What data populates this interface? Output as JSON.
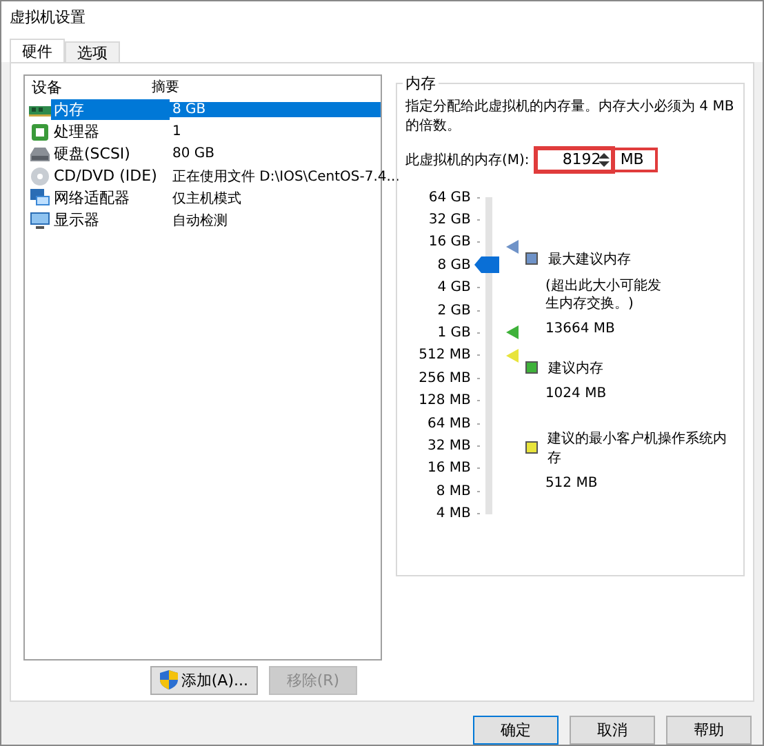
{
  "window": {
    "title": "虚拟机设置"
  },
  "tabs": [
    {
      "label": "硬件",
      "selected": true
    },
    {
      "label": "选项",
      "selected": false
    }
  ],
  "device_table": {
    "columns": [
      "设备",
      "摘要"
    ],
    "rows": [
      {
        "kind": "memory",
        "device": "内存",
        "summary": "8 GB",
        "selected": true
      },
      {
        "kind": "cpu",
        "device": "处理器",
        "summary": "1",
        "selected": false
      },
      {
        "kind": "disk",
        "device": "硬盘(SCSI)",
        "summary": "80 GB",
        "selected": false
      },
      {
        "kind": "cd",
        "device": "CD/DVD (IDE)",
        "summary": "正在使用文件 D:\\IOS\\CentOS-7.4...",
        "selected": false
      },
      {
        "kind": "network",
        "device": "网络适配器",
        "summary": "仅主机模式",
        "selected": false
      },
      {
        "kind": "display",
        "device": "显示器",
        "summary": "自动检测",
        "selected": false
      }
    ]
  },
  "device_buttons": [
    {
      "kind": "shield",
      "label": "添加(A)...",
      "disabled": false
    },
    {
      "kind": "plain",
      "label": "移除(R)",
      "disabled": true
    }
  ],
  "memory": {
    "title": "内存",
    "description": "指定分配给此虚拟机的内存量。内存大小必须为 4 MB 的倍数。",
    "field_label": "此虚拟机的内存(M):",
    "value": "8192",
    "unit": "MB",
    "level": 0.786,
    "scale": [
      "64 GB",
      "32 GB",
      "16 GB",
      "8 GB",
      "4 GB",
      "2 GB",
      "1 GB",
      "512 MB",
      "256 MB",
      "128 MB",
      "64 MB",
      "32 MB",
      "16 MB",
      "8 MB",
      "4 MB"
    ],
    "recommendations": [
      {
        "label": "最大建议内存",
        "note": "(超出此大小可能发生内存交换。)",
        "value": "13664 MB",
        "color": "#6f93c8"
      },
      {
        "label": "建议内存",
        "value": "1024 MB",
        "color": "#3fb23a"
      },
      {
        "label": "建议的最小客户机操作系统内存",
        "value": "512 MB",
        "color": "#e8e43c"
      }
    ],
    "slider_markers": [
      {
        "color": "#6f93c8",
        "level": 0.843
      },
      {
        "color": "#3fb23a",
        "level": 0.571
      },
      {
        "color": "#e8e43c",
        "level": 0.5
      }
    ]
  },
  "dialog_buttons": [
    {
      "label": "确定",
      "default": true
    },
    {
      "label": "取消",
      "default": false
    },
    {
      "label": "帮助",
      "default": false
    }
  ]
}
